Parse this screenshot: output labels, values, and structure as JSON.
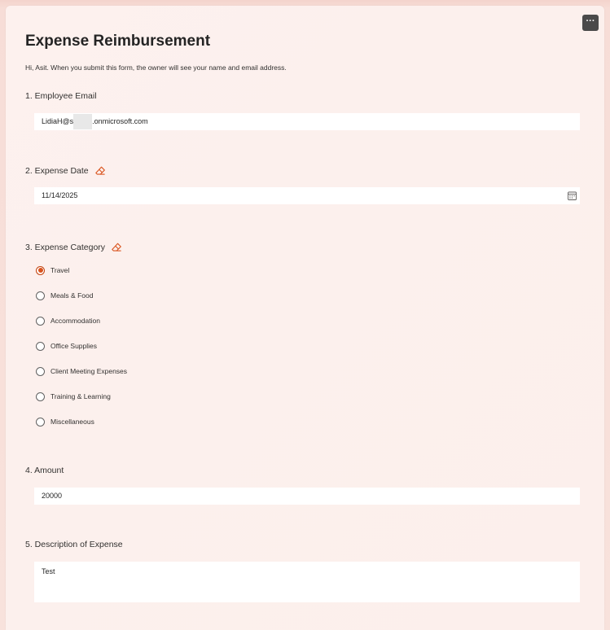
{
  "app": {
    "accent_color": "#d9531e",
    "more_button_label": "···"
  },
  "form": {
    "title": "Expense Reimbursement",
    "notice": "Hi, Asit. When you submit this form, the owner will see your name and email address."
  },
  "questions": {
    "q1": {
      "label": "1. Employee Email",
      "value_prefix": "LidiaH@s",
      "value_suffix": ".onmicrosoft.com"
    },
    "q2": {
      "label": "2. Expense Date",
      "value": "11/14/2025",
      "icon": "calendar-icon"
    },
    "q3": {
      "label": "3. Expense Category",
      "selected": "Travel",
      "options": [
        {
          "label": "Travel",
          "checked": true
        },
        {
          "label": "Meals & Food",
          "checked": false
        },
        {
          "label": "Accommodation",
          "checked": false
        },
        {
          "label": "Office Supplies",
          "checked": false
        },
        {
          "label": "Client Meeting Expenses",
          "checked": false
        },
        {
          "label": "Training & Learning",
          "checked": false
        },
        {
          "label": "Miscellaneous",
          "checked": false
        }
      ]
    },
    "q4": {
      "label": "4. Amount",
      "value": "20000"
    },
    "q5": {
      "label": "5. Description of Expense",
      "value": "Test"
    }
  }
}
